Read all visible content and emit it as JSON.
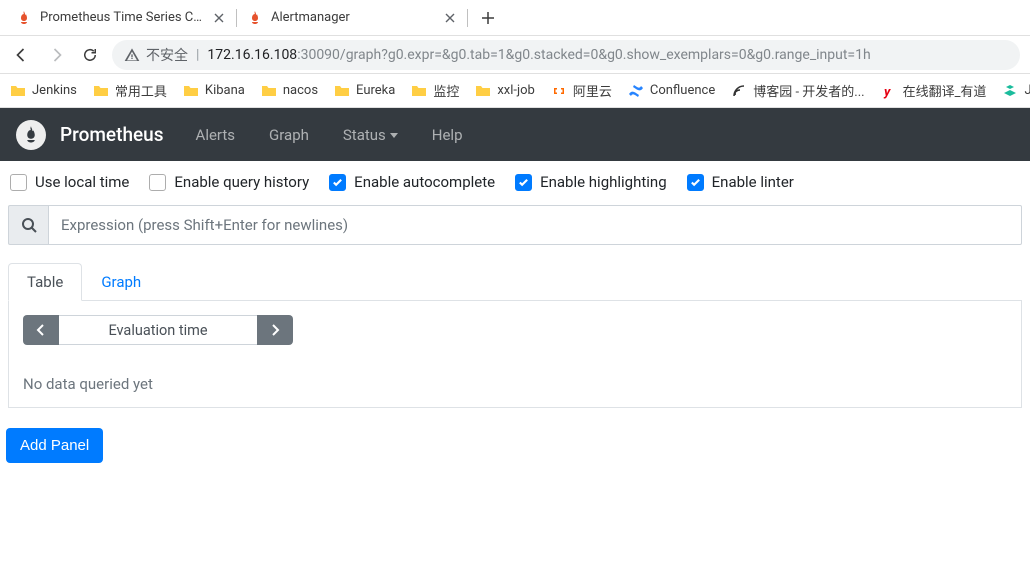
{
  "browser": {
    "tabs": [
      {
        "title": "Prometheus Time Series Collec",
        "active": true
      },
      {
        "title": "Alertmanager",
        "active": false
      }
    ],
    "security_label": "不安全",
    "url": {
      "host": "172.16.16.108",
      "rest": ":30090/graph?g0.expr=&g0.tab=1&g0.stacked=0&g0.show_exemplars=0&g0.range_input=1h"
    },
    "bookmarks": [
      {
        "label": "Jenkins",
        "type": "folder"
      },
      {
        "label": "常用工具",
        "type": "folder"
      },
      {
        "label": "Kibana",
        "type": "folder"
      },
      {
        "label": "nacos",
        "type": "folder"
      },
      {
        "label": "Eureka",
        "type": "folder"
      },
      {
        "label": "监控",
        "type": "folder"
      },
      {
        "label": "xxl-job",
        "type": "folder"
      },
      {
        "label": "阿里云",
        "type": "aliyun"
      },
      {
        "label": "Confluence",
        "type": "confluence"
      },
      {
        "label": "博客园 - 开发者的...",
        "type": "cnblogs"
      },
      {
        "label": "在线翻译_有道",
        "type": "youdao"
      },
      {
        "label": "Ju",
        "type": "juejin"
      }
    ]
  },
  "nav": {
    "brand": "Prometheus",
    "links": {
      "alerts": "Alerts",
      "graph": "Graph",
      "status": "Status",
      "help": "Help"
    }
  },
  "options": {
    "local_time": "Use local time",
    "query_history": "Enable query history",
    "autocomplete": "Enable autocomplete",
    "highlighting": "Enable highlighting",
    "linter": "Enable linter"
  },
  "expression": {
    "placeholder": "Expression (press Shift+Enter for newlines)"
  },
  "tabs": {
    "table": "Table",
    "graph": "Graph"
  },
  "panel": {
    "eval_placeholder": "Evaluation time",
    "no_data": "No data queried yet"
  },
  "actions": {
    "add_panel": "Add Panel"
  }
}
